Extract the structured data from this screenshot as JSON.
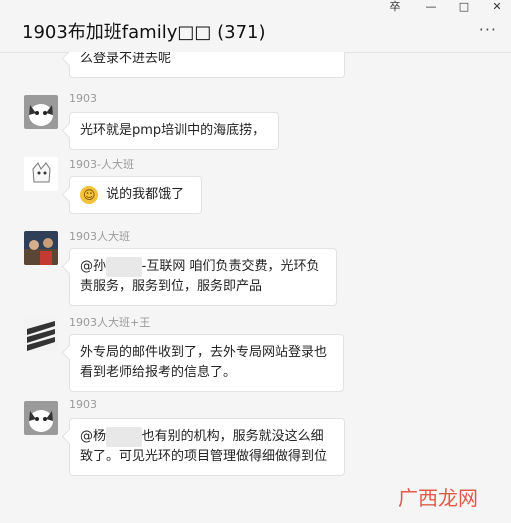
{
  "window": {
    "title": "1903布加班family□□ (371)",
    "controls": [
      "卒",
      "—",
      "□",
      "✕"
    ],
    "more": "···"
  },
  "messages": [
    {
      "sender": "",
      "text": "么登录不进去呢"
    },
    {
      "sender": "1903",
      "text": "光环就是pmp培训中的海底捞，"
    },
    {
      "sender": "1903-人大班",
      "emoji": "😂",
      "text": "说的我都饿了"
    },
    {
      "sender": "1903人大班",
      "parts": [
        "@孙",
        "-互联网",
        " 咱们负责交费，光环负责服务，服务到位，服务即产品"
      ]
    },
    {
      "sender": "1903人大班+王",
      "text": "外专局的邮件收到了，去外专局网站登录也看到老师给报考的信息了。"
    },
    {
      "sender": "1903",
      "parts": [
        "@杨",
        "也有别的机构，服务就没这么细致了。可见光环的项目管理做得细做得到位"
      ]
    }
  ],
  "watermark": "广西龙网",
  "avatars": [
    "cat-avatar",
    "cat-sticker-avatar",
    "group-photo-avatar",
    "zebra-pattern-avatar",
    "cat-avatar"
  ]
}
